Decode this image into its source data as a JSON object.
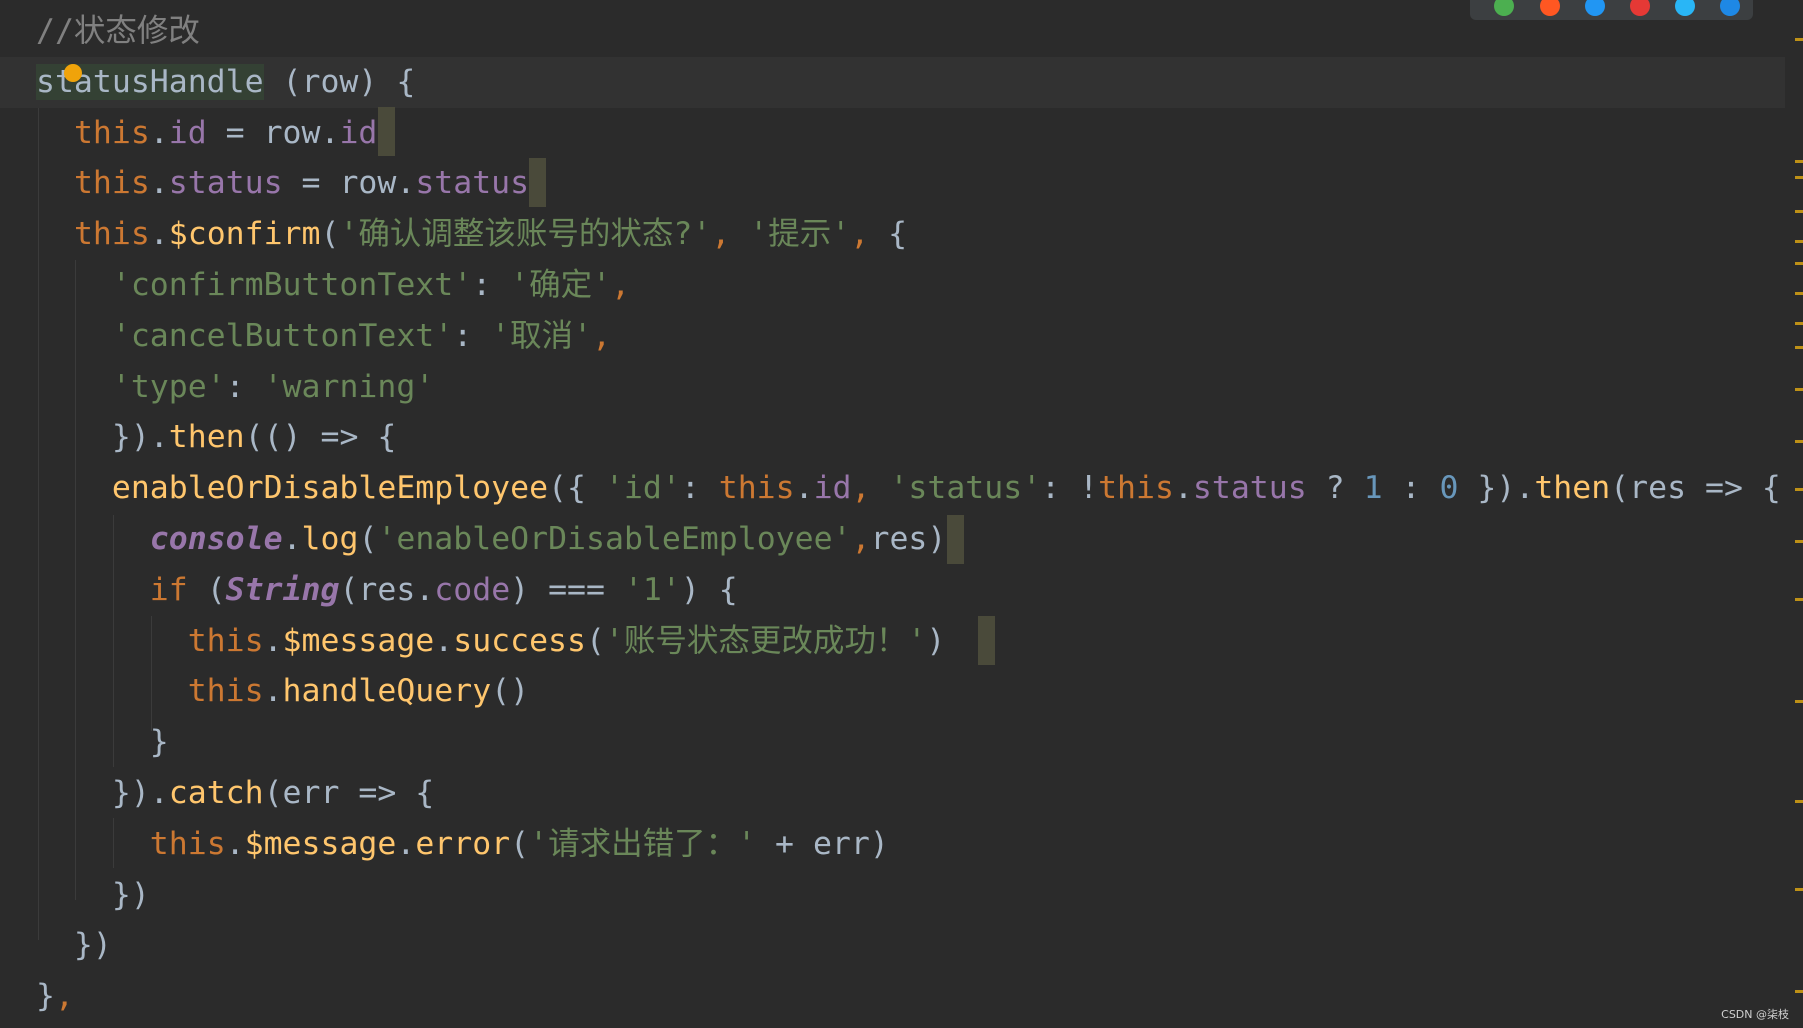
{
  "editor": {
    "lines": [
      [
        {
          "t": "//状态修改",
          "c": "cmt"
        }
      ],
      [
        {
          "t": "statusHandle",
          "c": "fn-decl"
        },
        {
          "t": " (row) {",
          "c": "plain"
        }
      ],
      [
        {
          "t": "  ",
          "c": "plain"
        },
        {
          "t": "this",
          "c": "this"
        },
        {
          "t": ".",
          "c": "plain"
        },
        {
          "t": "id",
          "c": "prop"
        },
        {
          "t": " = row.",
          "c": "plain"
        },
        {
          "t": "id",
          "c": "prop"
        }
      ],
      [
        {
          "t": "  ",
          "c": "plain"
        },
        {
          "t": "this",
          "c": "this"
        },
        {
          "t": ".",
          "c": "plain"
        },
        {
          "t": "status",
          "c": "prop"
        },
        {
          "t": " = row.",
          "c": "plain"
        },
        {
          "t": "status",
          "c": "prop"
        }
      ],
      [
        {
          "t": "  ",
          "c": "plain"
        },
        {
          "t": "this",
          "c": "this"
        },
        {
          "t": ".",
          "c": "plain"
        },
        {
          "t": "$confirm",
          "c": "fn"
        },
        {
          "t": "(",
          "c": "plain"
        },
        {
          "t": "'确认调整该账号的状态?'",
          "c": "str"
        },
        {
          "t": ", ",
          "c": "kw"
        },
        {
          "t": "'提示'",
          "c": "str"
        },
        {
          "t": ", ",
          "c": "kw"
        },
        {
          "t": "{",
          "c": "plain"
        }
      ],
      [
        {
          "t": "    ",
          "c": "plain"
        },
        {
          "t": "'confirmButtonText'",
          "c": "str"
        },
        {
          "t": ": ",
          "c": "plain"
        },
        {
          "t": "'确定'",
          "c": "str"
        },
        {
          "t": ",",
          "c": "kw"
        }
      ],
      [
        {
          "t": "    ",
          "c": "plain"
        },
        {
          "t": "'cancelButtonText'",
          "c": "str"
        },
        {
          "t": ": ",
          "c": "plain"
        },
        {
          "t": "'取消'",
          "c": "str"
        },
        {
          "t": ",",
          "c": "kw"
        }
      ],
      [
        {
          "t": "    ",
          "c": "plain"
        },
        {
          "t": "'type'",
          "c": "str"
        },
        {
          "t": ": ",
          "c": "plain"
        },
        {
          "t": "'warning'",
          "c": "str"
        }
      ],
      [
        {
          "t": "    }).",
          "c": "plain"
        },
        {
          "t": "then",
          "c": "fn"
        },
        {
          "t": "(() => {",
          "c": "plain"
        }
      ],
      [
        {
          "t": "    ",
          "c": "plain"
        },
        {
          "t": "enableOrDisableEmployee",
          "c": "fn"
        },
        {
          "t": "({ ",
          "c": "plain"
        },
        {
          "t": "'id'",
          "c": "str"
        },
        {
          "t": ": ",
          "c": "plain"
        },
        {
          "t": "this",
          "c": "this"
        },
        {
          "t": ".",
          "c": "plain"
        },
        {
          "t": "id",
          "c": "prop"
        },
        {
          "t": ", ",
          "c": "kw"
        },
        {
          "t": "'status'",
          "c": "str"
        },
        {
          "t": ": !",
          "c": "plain"
        },
        {
          "t": "this",
          "c": "this"
        },
        {
          "t": ".",
          "c": "plain"
        },
        {
          "t": "status",
          "c": "prop"
        },
        {
          "t": " ? ",
          "c": "plain"
        },
        {
          "t": "1",
          "c": "num"
        },
        {
          "t": " : ",
          "c": "plain"
        },
        {
          "t": "0",
          "c": "num"
        },
        {
          "t": " }).",
          "c": "plain"
        },
        {
          "t": "then",
          "c": "fn"
        },
        {
          "t": "(res => {",
          "c": "plain"
        }
      ],
      [
        {
          "t": "      ",
          "c": "plain"
        },
        {
          "t": "console",
          "c": "global"
        },
        {
          "t": ".",
          "c": "plain"
        },
        {
          "t": "log",
          "c": "fn"
        },
        {
          "t": "(",
          "c": "plain"
        },
        {
          "t": "'enableOrDisableEmployee'",
          "c": "str"
        },
        {
          "t": ",",
          "c": "kw"
        },
        {
          "t": "res)",
          "c": "plain"
        }
      ],
      [
        {
          "t": "      ",
          "c": "plain"
        },
        {
          "t": "if",
          "c": "kw"
        },
        {
          "t": " (",
          "c": "plain"
        },
        {
          "t": "String",
          "c": "global"
        },
        {
          "t": "(res.",
          "c": "plain"
        },
        {
          "t": "code",
          "c": "prop"
        },
        {
          "t": ") === ",
          "c": "plain"
        },
        {
          "t": "'1'",
          "c": "str"
        },
        {
          "t": ") {",
          "c": "plain"
        }
      ],
      [
        {
          "t": "        ",
          "c": "plain"
        },
        {
          "t": "this",
          "c": "this"
        },
        {
          "t": ".",
          "c": "plain"
        },
        {
          "t": "$message",
          "c": "fn"
        },
        {
          "t": ".",
          "c": "plain"
        },
        {
          "t": "success",
          "c": "fn"
        },
        {
          "t": "(",
          "c": "plain"
        },
        {
          "t": "'账号状态更改成功！'",
          "c": "str"
        },
        {
          "t": ")",
          "c": "plain"
        }
      ],
      [
        {
          "t": "        ",
          "c": "plain"
        },
        {
          "t": "this",
          "c": "this"
        },
        {
          "t": ".",
          "c": "plain"
        },
        {
          "t": "handleQuery",
          "c": "fn"
        },
        {
          "t": "()",
          "c": "plain"
        }
      ],
      [
        {
          "t": "      }",
          "c": "plain"
        }
      ],
      [
        {
          "t": "    }).",
          "c": "plain"
        },
        {
          "t": "catch",
          "c": "fn"
        },
        {
          "t": "(err => {",
          "c": "plain"
        }
      ],
      [
        {
          "t": "      ",
          "c": "plain"
        },
        {
          "t": "this",
          "c": "this"
        },
        {
          "t": ".",
          "c": "plain"
        },
        {
          "t": "$message",
          "c": "fn"
        },
        {
          "t": ".",
          "c": "plain"
        },
        {
          "t": "error",
          "c": "fn"
        },
        {
          "t": "(",
          "c": "plain"
        },
        {
          "t": "'请求出错了：'",
          "c": "str"
        },
        {
          "t": " + err)",
          "c": "plain"
        }
      ],
      [
        {
          "t": "    })",
          "c": "plain"
        }
      ],
      [
        {
          "t": "  })",
          "c": "plain"
        }
      ],
      [
        {
          "t": "}",
          "c": "plain"
        },
        {
          "t": ",",
          "c": "kw"
        }
      ]
    ],
    "current_line_index": 1
  },
  "colors": {
    "background": "#2b2b2b",
    "keyword": "#cc7832",
    "string": "#6a8759",
    "property": "#9876aa",
    "function": "#ffc66d",
    "number": "#6897bb",
    "comment": "#808080",
    "text": "#a9b7c6",
    "bulb": "#f0a30a"
  },
  "browser_icons": [
    "chrome-icon",
    "firefox-icon",
    "safari-icon",
    "opera-icon",
    "ie-icon",
    "edge-icon"
  ],
  "watermark": "CSDN @柒枝"
}
